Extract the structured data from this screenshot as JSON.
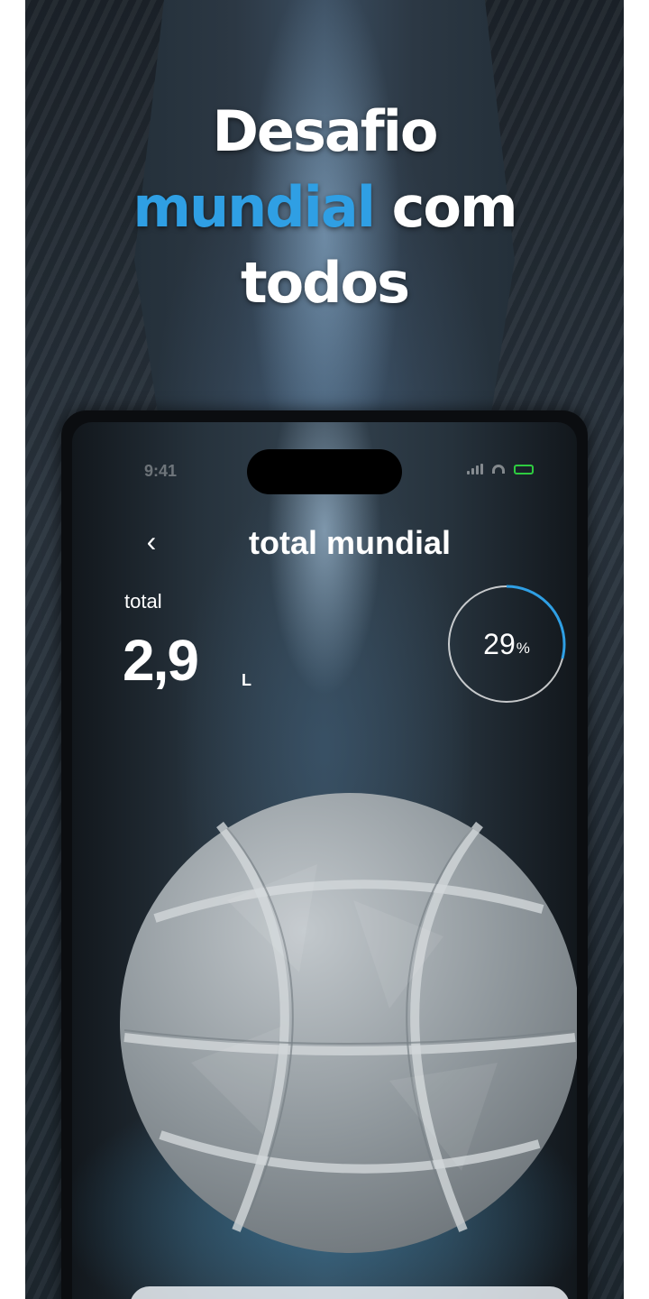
{
  "headline": {
    "line1": "Desafio",
    "accent": "mundial",
    "rest": " com",
    "line3": "todos"
  },
  "status_bar": {
    "time": "9:41"
  },
  "nav": {
    "back_glyph": "‹",
    "title": "total mundial"
  },
  "stats": {
    "label": "total",
    "value": "2,9",
    "unit": "L"
  },
  "progress": {
    "value": "29",
    "symbol": "%",
    "fraction": 0.29,
    "ring_color": "#2f9fe4"
  },
  "colors": {
    "accent": "#2f9fe4",
    "battery": "#2ecc40"
  },
  "icons": {
    "back": "chevron-left-icon",
    "signal": "signal-icon",
    "wifi": "wifi-icon",
    "battery": "battery-icon"
  }
}
